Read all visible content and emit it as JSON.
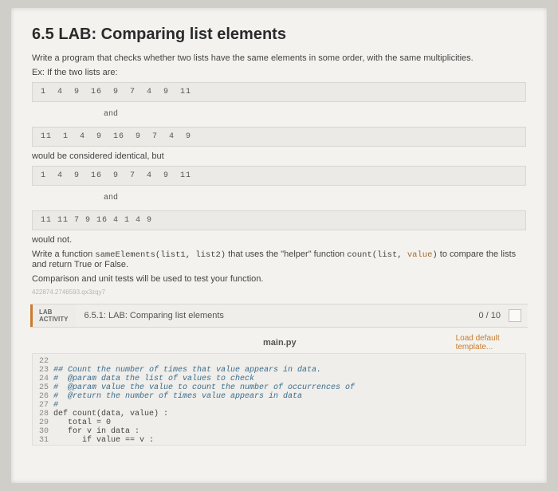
{
  "title": "6.5 LAB: Comparing list elements",
  "intro1": "Write a program that checks whether two lists have the same elements in some order, with the same multiplicities.",
  "intro2": "Ex: If the two lists are:",
  "block1": "1  4  9  16  9  7  4  9  11",
  "and": "and",
  "block2": "11  1  4  9  16  9  7  4  9",
  "line3": "would be considered identical, but",
  "block3": "1  4  9  16  9  7  4  9  11",
  "block4": "11 11 7 9 16 4 1 4 9",
  "line4": "would not.",
  "line5a": "Write a function ",
  "line5code1": "sameElements(list1, list2)",
  "line5b": " that uses the \"helper\" function ",
  "line5code2": "count(list, ",
  "line5val": "value",
  "line5code3": ")",
  "line5c": " to compare the lists and return True or False.",
  "line6": "Comparison and unit tests will be used to test your function.",
  "tiny": "422874.2746593.qx3zqy7",
  "lab_badge1": "LAB",
  "lab_badge2": "ACTIVITY",
  "lab_title": "6.5.1: LAB: Comparing list elements",
  "lab_score": "0 / 10",
  "file_name": "main.py",
  "load_link": "Load default template...",
  "editor_lines": [
    {
      "n": "22",
      "t": "",
      "c": true
    },
    {
      "n": "23",
      "t": "## Count the number of times that value appears in data.",
      "c": true
    },
    {
      "n": "24",
      "t": "#  @param data the list of values to check",
      "c": true
    },
    {
      "n": "25",
      "t": "#  @param value the value to count the number of occurrences of",
      "c": true
    },
    {
      "n": "26",
      "t": "#  @return the number of times value appears in data",
      "c": true
    },
    {
      "n": "27",
      "t": "#",
      "c": true
    },
    {
      "n": "28",
      "t": "def count(data, value) :",
      "c": false
    },
    {
      "n": "29",
      "t": "   total = 0",
      "c": false
    },
    {
      "n": "30",
      "t": "   for v in data :",
      "c": false
    },
    {
      "n": "31",
      "t": "      if value == v :",
      "c": false
    }
  ]
}
